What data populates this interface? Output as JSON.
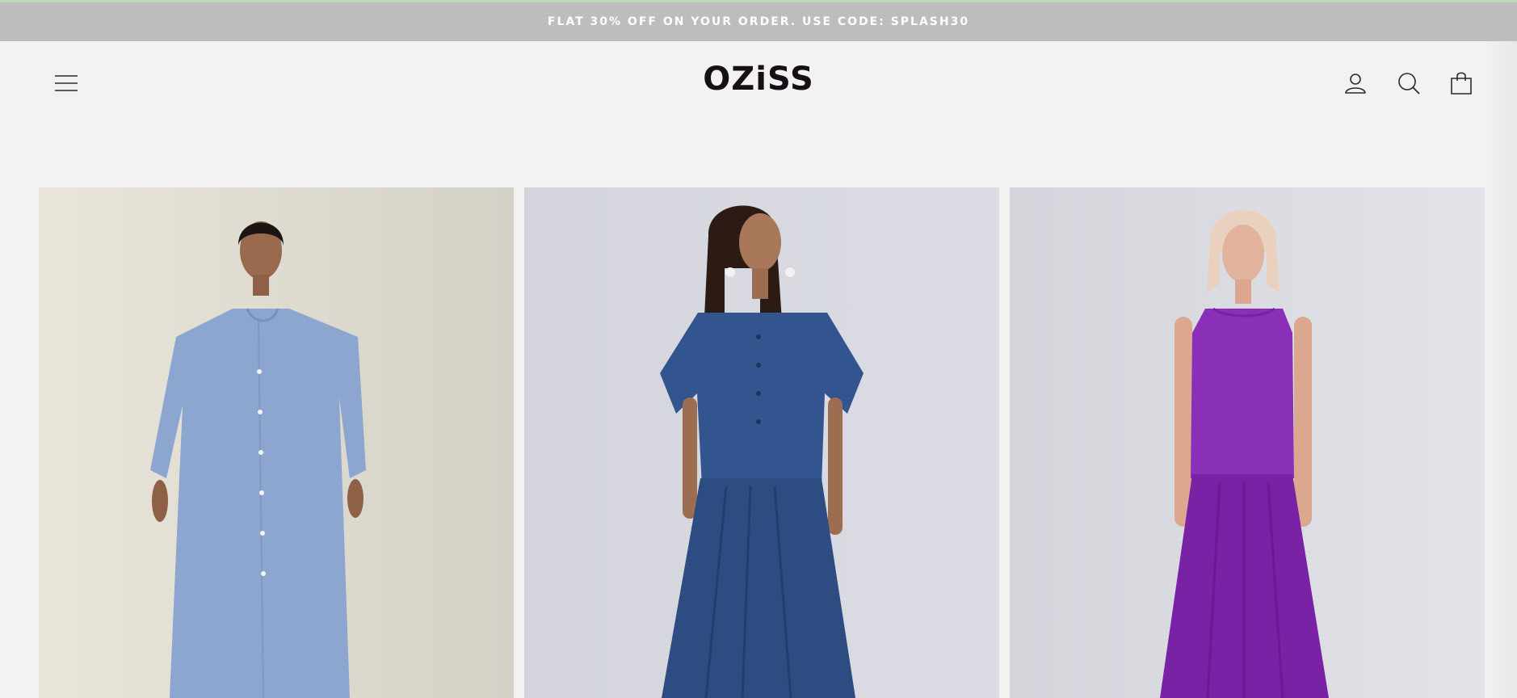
{
  "announcement": {
    "text": "FLAT 30% OFF ON YOUR ORDER. USE CODE: SPLASH30"
  },
  "header": {
    "logo": "OZiSS",
    "icons": [
      "menu-icon",
      "account-icon",
      "search-icon",
      "cart-icon"
    ]
  },
  "colors": {
    "announcement_bg": "#bdbdbd",
    "accent_line": "#b9dcb6",
    "page_bg": "#f2f2f2",
    "logo": "#161016"
  },
  "products": [
    {
      "image": "model in light blue button-down shirt dress",
      "color": "#8da6cf"
    },
    {
      "image": "model in navy blue button top and skirt set",
      "color": "#33558f"
    },
    {
      "image": "model in purple sleeveless top and skirt set",
      "color": "#8a2fb8"
    }
  ]
}
